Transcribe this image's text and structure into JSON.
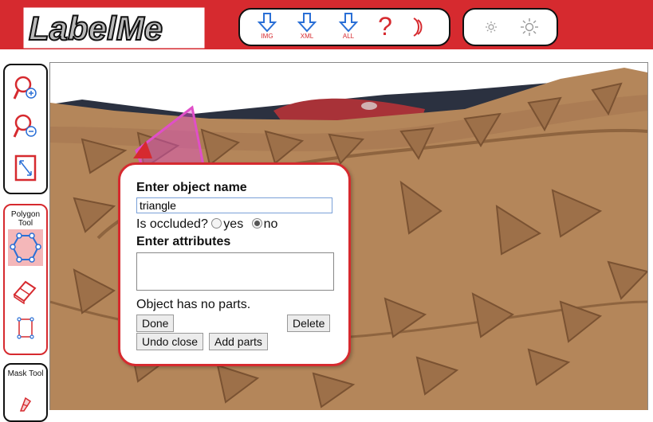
{
  "header": {
    "logo_text": "LabelMe",
    "toolbar": [
      {
        "label": "IMG",
        "icon": "download-arrow-icon"
      },
      {
        "label": "XML",
        "icon": "download-arrow-icon"
      },
      {
        "label": "ALL",
        "icon": "download-arrow-icon"
      },
      {
        "label": "",
        "icon": "help-question-icon"
      },
      {
        "label": "",
        "icon": "moon-icon"
      }
    ],
    "brightness": [
      {
        "icon": "brightness-down-icon"
      },
      {
        "icon": "brightness-up-icon"
      }
    ]
  },
  "tools": {
    "zoom": [
      "zoom-in-icon",
      "zoom-out-icon",
      "fit-image-icon"
    ],
    "polygon_title": "Polygon Tool",
    "mask_title": "Mask Tool"
  },
  "dialog": {
    "object_name_heading": "Enter object name",
    "object_name_value": "triangle",
    "occluded_label": "Is occluded?",
    "yes_label": "yes",
    "no_label": "no",
    "occluded_selected": "no",
    "attributes_heading": "Enter attributes",
    "attributes_value": "",
    "parts_text": "Object has no parts.",
    "done_label": "Done",
    "delete_label": "Delete",
    "undo_close_label": "Undo close",
    "add_parts_label": "Add parts"
  },
  "colors": {
    "brand_red": "#d62a2f",
    "polygon_fill": "#e04fc8",
    "accent_blue": "#2a6fd6"
  }
}
